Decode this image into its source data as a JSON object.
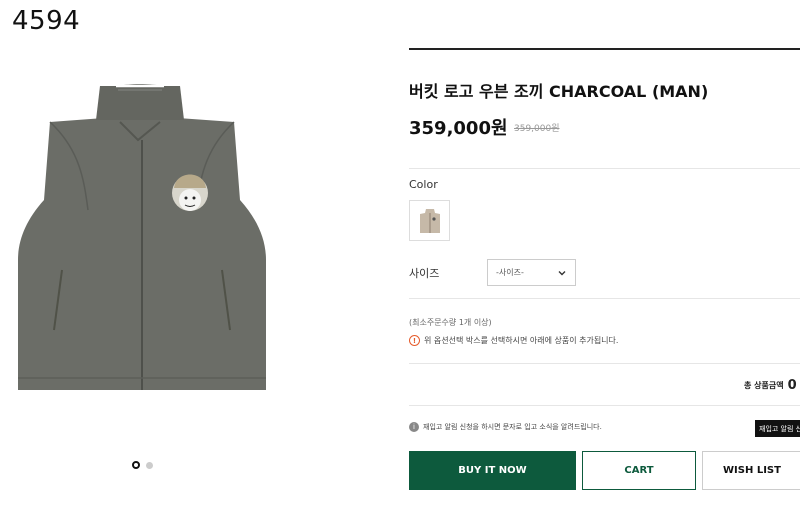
{
  "product_code": "4594",
  "product": {
    "title": "버킷 로고 우븐 조끼 CHARCOAL (MAN)",
    "price": "359,000원",
    "original_price": "359,000원"
  },
  "options": {
    "color_label": "Color",
    "size_label": "사이즈",
    "size_selected": "-사이즈-"
  },
  "messages": {
    "min_qty": "(최소주문수량 1개 이상)",
    "notice": "위 옵션선택 박스를 선택하시면 아래에 상품이 추가됩니다.",
    "notice_icon": "!",
    "restock_info": "재입고 알림 신청을 하시면 문자로 입고 소식을 알려드립니다.",
    "restock_icon": "i"
  },
  "total": {
    "label": "총 상품금액",
    "value": "0"
  },
  "buttons": {
    "restock": "재입고 알림 신청",
    "buy_now": "BUY IT NOW",
    "cart": "CART",
    "wish": "WISH LIST"
  },
  "gallery": {
    "slide_count": 2,
    "active_index": 0
  },
  "colors": {
    "accent": "#0d5a3d",
    "vest": "#6b6d67"
  }
}
